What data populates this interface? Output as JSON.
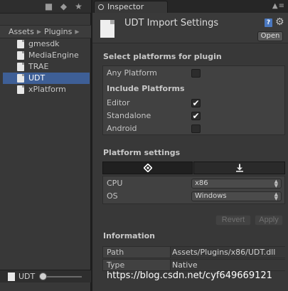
{
  "project": {
    "breadcrumb": [
      "Assets",
      "Plugins"
    ],
    "files": [
      {
        "name": "gmesdk",
        "selected": false
      },
      {
        "name": "MediaEngine",
        "selected": false
      },
      {
        "name": "TRAE",
        "selected": false
      },
      {
        "name": "UDT",
        "selected": true
      },
      {
        "name": "xPlatform",
        "selected": false
      }
    ],
    "footer_label": "UDT"
  },
  "inspector": {
    "tab_label": "Inspector",
    "title": "UDT Import Settings",
    "open_button": "Open",
    "select_platforms_header": "Select platforms for plugin",
    "any_platform_label": "Any Platform",
    "any_platform_checked": false,
    "include_platforms_header": "Include Platforms",
    "platforms": [
      {
        "label": "Editor",
        "checked": true
      },
      {
        "label": "Standalone",
        "checked": true
      },
      {
        "label": "Android",
        "checked": false
      }
    ],
    "platform_settings_header": "Platform settings",
    "cpu_label": "CPU",
    "cpu_value": "x86",
    "os_label": "OS",
    "os_value": "Windows",
    "revert_button": "Revert",
    "apply_button": "Apply",
    "information_header": "Information",
    "path_label": "Path",
    "path_value": "Assets/Plugins/x86/UDT.dll",
    "type_label": "Type",
    "type_value": "Native"
  },
  "watermark": "https://blog.csdn.net/cyf649669121",
  "icons": {
    "checkmark": "✔",
    "unity": "unity-icon",
    "download": "download-icon"
  },
  "colors": {
    "selection": "#3e5f96",
    "panel": "#383838",
    "background": "#1e1e1e"
  }
}
